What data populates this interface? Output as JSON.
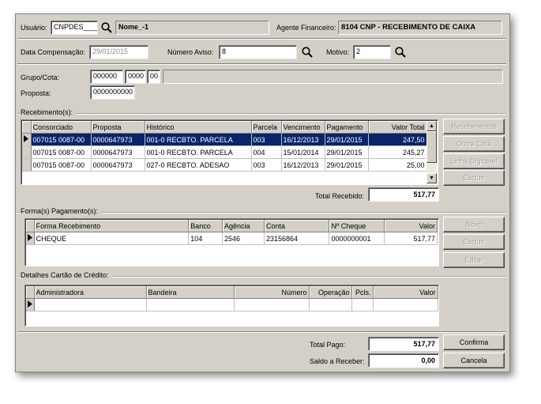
{
  "header": {
    "usuario_label": "Usuário:",
    "usuario_value": "CNPDES____",
    "nome_value": "Nome_-1",
    "agente_label": "Agente Financeiro:",
    "agente_value": "8104  CNP - RECEBIMENTO DE CAIXA"
  },
  "row2": {
    "data_label": "Data Compensação:",
    "data_value": "29/01/2015",
    "aviso_label": "Número Aviso:",
    "aviso_value": "8",
    "motivo_label": "Motivo:",
    "motivo_value": "2"
  },
  "grupo": {
    "label": "Grupo/Cota:",
    "v1": "000000",
    "v2": "0000",
    "v3": "00",
    "v4": "",
    "proposta_label": "Proposta:",
    "proposta_value": "0000000000"
  },
  "recebimentos": {
    "section_label": "Recebimento(s):",
    "columns": [
      "Consorciado",
      "Proposta",
      "Histórico",
      "Parcela",
      "Vencimento",
      "Pagamento",
      "Valor Total"
    ],
    "rows": [
      [
        "007015 0087-00",
        "0000647973",
        "001-0 RECBTO. PARCELA",
        "003",
        "16/12/2013",
        "29/01/2015",
        "247,50"
      ],
      [
        "007015 0087-00",
        "0000647973",
        "001-0 RECBTO. PARCELA",
        "004",
        "15/01/2014",
        "29/01/2015",
        "245,27"
      ],
      [
        "007015 0087-00",
        "0000647973",
        "027-0 RECBTO. ADESAO",
        "003",
        "16/12/2013",
        "29/01/2015",
        "25,00"
      ]
    ],
    "selected_row": 0,
    "total_label": "Total Recebido:",
    "total_value": "517,77",
    "buttons": [
      "Recebimentos",
      "Outra Cota",
      "Linha Digitável",
      "Excluir"
    ]
  },
  "formas": {
    "section_label": "Forma(s) Pagamento(s):",
    "columns": [
      "Forma Recebimento",
      "Banco",
      "Agência",
      "Conta",
      "Nº Cheque",
      "Valor"
    ],
    "rows": [
      [
        "CHEQUE",
        "104",
        "2546",
        "23156864",
        "0000000001",
        "517,77"
      ]
    ],
    "buttons": [
      "Novo",
      "Excluir",
      "Editar"
    ]
  },
  "cartao": {
    "section_label": "Detalhes Cartão de Crédito:",
    "columns": [
      "Administradora",
      "Bandeira",
      "Número",
      "Operação",
      "Pcls.",
      "Valor"
    ]
  },
  "footer": {
    "total_pago_label": "Total Pago:",
    "total_pago_value": "517,77",
    "saldo_label": "Saldo a Receber:",
    "saldo_value": "0,00",
    "confirma": "Confirma",
    "cancela": "Cancela"
  },
  "colors": {
    "selection": "#0a246a",
    "window_bg": "#d4d0c8"
  },
  "icons": [
    "search-icon",
    "row-indicator-icon",
    "scroll-up-icon",
    "scroll-down-icon"
  ]
}
